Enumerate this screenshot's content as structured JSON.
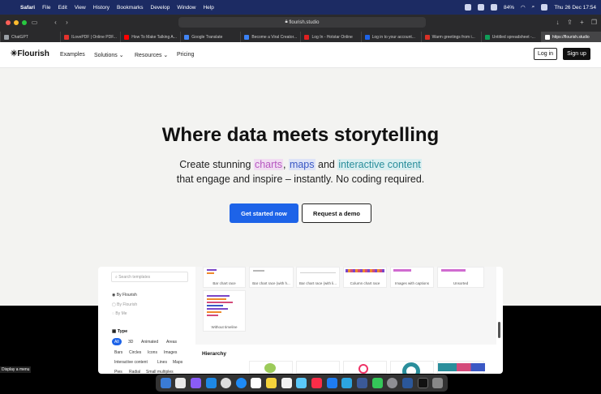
{
  "menubar": {
    "app": "Safari",
    "items": [
      "File",
      "Edit",
      "View",
      "History",
      "Bookmarks",
      "Develop",
      "Window",
      "Help"
    ],
    "battery": "84%",
    "datetime": "Thu 26 Dec 17:54"
  },
  "browser": {
    "url": "flourish.studio",
    "tabs": [
      {
        "label": "ChatGPT",
        "color": "#9aa0a6"
      },
      {
        "label": "ILovePDF | Online PDF...",
        "color": "#e5322d"
      },
      {
        "label": "How To Make Talking A...",
        "color": "#ff0000"
      },
      {
        "label": "Google Translate",
        "color": "#4285f4"
      },
      {
        "label": "Become a Viral Creator...",
        "color": "#3b82f6"
      },
      {
        "label": "Log In - Hotstar Online",
        "color": "#e02020"
      },
      {
        "label": "Log in to your account...",
        "color": "#1d63e8"
      },
      {
        "label": "Warm greetings from i...",
        "color": "#d93025"
      },
      {
        "label": "Untitled spreadsheet -...",
        "color": "#0f9d58"
      },
      {
        "label": "https://flourish.studio",
        "color": "#ffffff"
      }
    ],
    "active_tab": 9
  },
  "site": {
    "logo": "✳Flourish",
    "nav": [
      "Examples",
      "Solutions ⌄",
      "Resources ⌄",
      "Pricing"
    ],
    "login": "Log in",
    "signup": "Sign up",
    "hero_title": "Where data meets storytelling",
    "hero_sub_1a": "Create stunning ",
    "hero_sub_charts": "charts",
    "hero_sub_comma": ", ",
    "hero_sub_maps": "maps",
    "hero_sub_and": " and ",
    "hero_sub_ic": "interactive content",
    "hero_sub_2": "that engage and inspire – instantly. No coding required.",
    "cta_primary": "Get started now",
    "cta_secondary": "Request a demo"
  },
  "templates": {
    "search_placeholder": "Search templates",
    "filters": [
      "By Flourish",
      "By Flourish",
      "By Me"
    ],
    "type_heading": "Type",
    "chips": [
      "All",
      "3D",
      "Animated",
      "Areas",
      "Bars",
      "Circles",
      "Icons",
      "Images",
      "Interactive content",
      "Lines",
      "Maps",
      "Pies",
      "Radial",
      "Small multiples"
    ],
    "cards": [
      "Bar chart race",
      "Bar chart race (with h...",
      "Bar chart race (with li...",
      "Column chart race",
      "Images with captions",
      "Unsorted",
      "Without timeline"
    ],
    "section": "Hierarchy"
  },
  "status": {
    "tooltip": "Display a menu"
  }
}
